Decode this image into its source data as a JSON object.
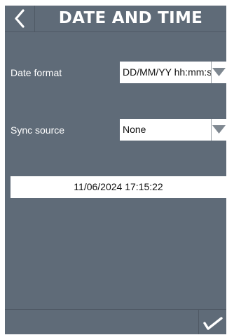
{
  "header": {
    "title": "DATE AND TIME",
    "back_icon": "chevron-left-icon"
  },
  "date_format": {
    "label": "Date format",
    "value": "DD/MM/YY hh:mm:ss",
    "arrow_icon": "triangle-down-icon"
  },
  "sync_source": {
    "label": "Sync source",
    "value": "None",
    "arrow_icon": "triangle-down-icon"
  },
  "current_datetime": "11/06/2024 17:15:22",
  "footer": {
    "confirm_icon": "checkmark-icon"
  },
  "colors": {
    "background": "#5f6b78",
    "text": "#ffffff",
    "field": "#ffffff"
  }
}
